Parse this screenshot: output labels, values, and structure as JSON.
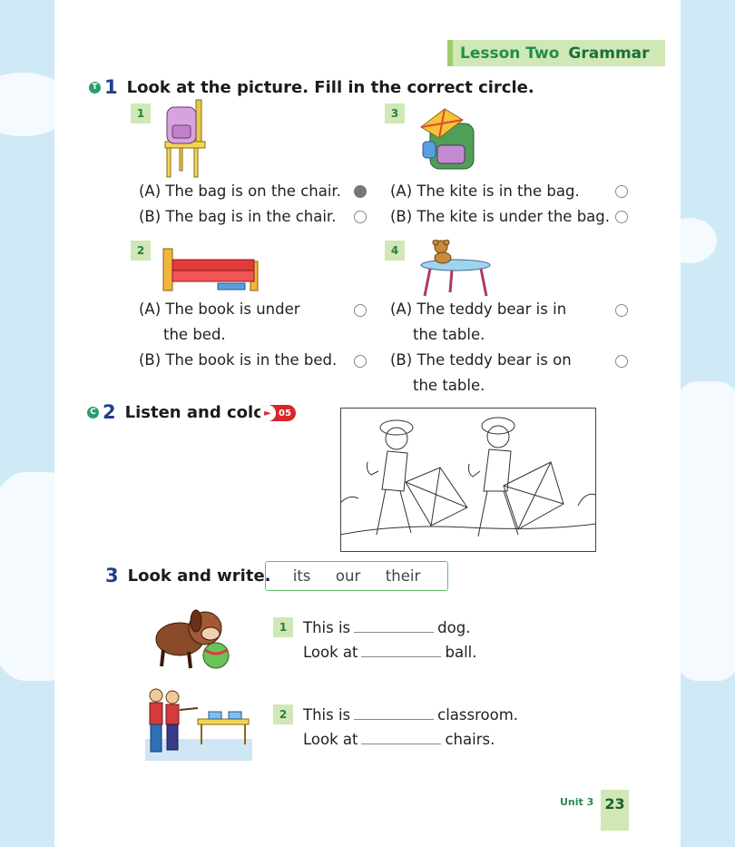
{
  "lesson": {
    "part1": "Lesson Two",
    "part2": "Grammar"
  },
  "section1": {
    "icon": "T",
    "number": "1",
    "title": "Look at the picture. Fill in the correct circle.",
    "questions": [
      {
        "num": "1",
        "a": "(A) The bag is on the chair.",
        "b": "(B) The bag is in the chair."
      },
      {
        "num": "2",
        "a1": "(A) The book is under",
        "a2": "the bed.",
        "b": "(B) The book is in the bed."
      },
      {
        "num": "3",
        "a": "(A) The kite is in the bag.",
        "b": "(B) The kite is under the bag."
      },
      {
        "num": "4",
        "a1": "(A) The teddy bear is in",
        "a2": "the table.",
        "b1": "(B) The teddy bear is on",
        "b2": "the table."
      }
    ]
  },
  "section2": {
    "icon": "C",
    "number": "2",
    "title": "Listen and color.",
    "audio": "05"
  },
  "section3": {
    "number": "3",
    "title": "Look and write.",
    "words": [
      "its",
      "our",
      "their"
    ],
    "items": [
      {
        "num": "1",
        "l1a": "This is",
        "l1b": "dog.",
        "l2a": "Look at",
        "l2b": "ball."
      },
      {
        "num": "2",
        "l1a": "This is",
        "l1b": "classroom.",
        "l2a": "Look at",
        "l2b": "chairs."
      }
    ]
  },
  "footer": {
    "unit": "Unit 3",
    "page": "23"
  },
  "colors": {
    "accent_green": "#cfe8b5",
    "title_blue": "#1e3f8a",
    "audio_red": "#d9252b"
  }
}
